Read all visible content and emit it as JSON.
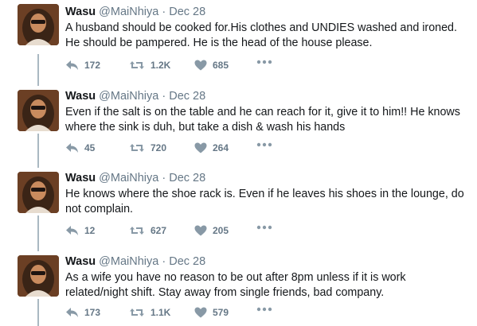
{
  "colors": {
    "text": "#14171a",
    "secondary": "#657786",
    "connector": "#aab8c2",
    "icon": "#8899a6"
  },
  "tweets": [
    {
      "name": "Wasu",
      "handle": "@MaiNhiya",
      "separator": "·",
      "date": "Dec 28",
      "text": "A husband should be cooked for.His clothes and UNDIES washed and ironed. He should be pampered. He is the head of the house please.",
      "replies": "172",
      "retweets": "1.2K",
      "likes": "685"
    },
    {
      "name": "Wasu",
      "handle": "@MaiNhiya",
      "separator": "·",
      "date": "Dec 28",
      "text": "Even if the salt is on the table and he can reach for it, give it to him!! He knows where the sink is duh, but take a dish & wash his hands",
      "replies": "45",
      "retweets": "720",
      "likes": "264"
    },
    {
      "name": "Wasu",
      "handle": "@MaiNhiya",
      "separator": "·",
      "date": "Dec 28",
      "text": "He knows where the shoe rack is. Even if he leaves his shoes in the lounge, do not complain.",
      "replies": "12",
      "retweets": "627",
      "likes": "205"
    },
    {
      "name": "Wasu",
      "handle": "@MaiNhiya",
      "separator": "·",
      "date": "Dec 28",
      "text": "As a wife you have no reason to be out after 8pm unless if it is work related/night shift. Stay away from single friends, bad company.",
      "replies": "173",
      "retweets": "1.1K",
      "likes": "579"
    }
  ],
  "icons": {
    "reply": "reply-icon",
    "retweet": "retweet-icon",
    "like": "heart-icon",
    "more": "more-icon"
  }
}
